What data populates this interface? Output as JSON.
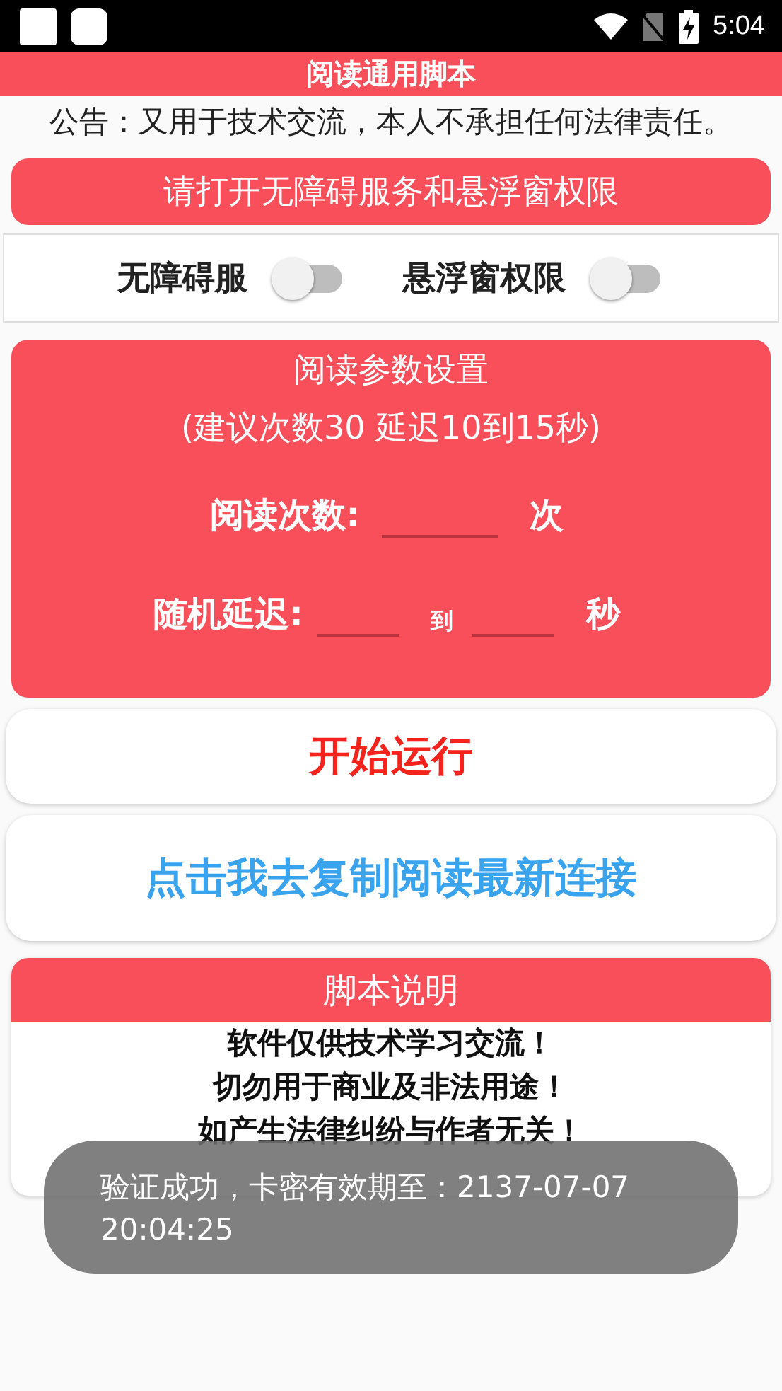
{
  "status_bar": {
    "time": "5:04"
  },
  "title": "阅读通用脚本",
  "notice": "公告：又用于技术交流，本人不承担任何法律责任。",
  "permission_button": "请打开无障碍服务和悬浮窗权限",
  "switches": [
    {
      "label": "无障碍服",
      "on": false
    },
    {
      "label": "悬浮窗权限",
      "on": false
    }
  ],
  "settings": {
    "title": "阅读参数设置",
    "hint": "(建议次数30  延迟10到15秒)",
    "count_row": {
      "label": "阅读次数:",
      "unit": "次"
    },
    "delay_row": {
      "label": "随机延迟:",
      "separator": "到",
      "unit": "秒"
    }
  },
  "start_button": "开始运行",
  "copy_button": "点击我去复制阅读最新连接",
  "script_info": {
    "title": "脚本说明",
    "lines": [
      "软件仅供技术学习交流！",
      "切勿用于商业及非法用途！",
      "如产生法律纠纷与作者无关！"
    ]
  },
  "toast": "验证成功，卡密有效期至：2137-07-07 20:04:25"
}
